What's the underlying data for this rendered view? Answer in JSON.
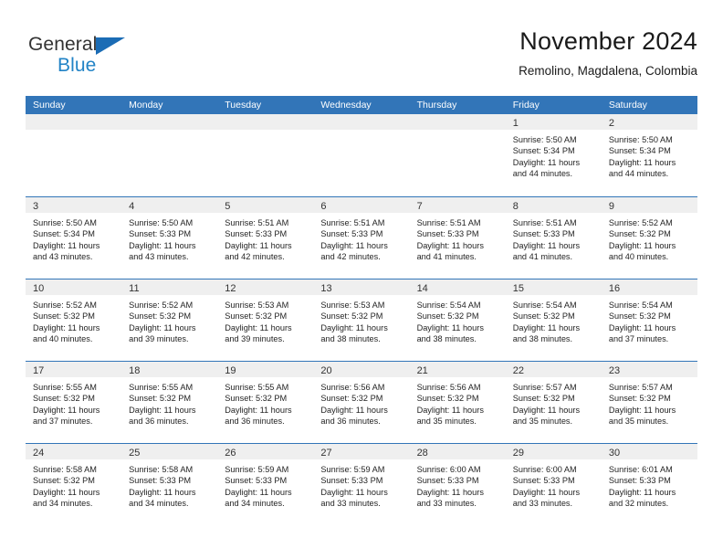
{
  "brand": {
    "name_part1": "General",
    "name_part2": "Blue",
    "accent_color": "#2283c6",
    "triangle_color": "#1b6cb5"
  },
  "header": {
    "title": "November 2024",
    "subtitle": "Remolino, Magdalena, Colombia"
  },
  "calendar": {
    "header_bg": "#3275b8",
    "daynumber_bg": "#efefef",
    "weekdays": [
      "Sunday",
      "Monday",
      "Tuesday",
      "Wednesday",
      "Thursday",
      "Friday",
      "Saturday"
    ],
    "weeks": [
      [
        {
          "day": "",
          "lines": []
        },
        {
          "day": "",
          "lines": []
        },
        {
          "day": "",
          "lines": []
        },
        {
          "day": "",
          "lines": []
        },
        {
          "day": "",
          "lines": []
        },
        {
          "day": "1",
          "lines": [
            "Sunrise: 5:50 AM",
            "Sunset: 5:34 PM",
            "Daylight: 11 hours",
            "and 44 minutes."
          ]
        },
        {
          "day": "2",
          "lines": [
            "Sunrise: 5:50 AM",
            "Sunset: 5:34 PM",
            "Daylight: 11 hours",
            "and 44 minutes."
          ]
        }
      ],
      [
        {
          "day": "3",
          "lines": [
            "Sunrise: 5:50 AM",
            "Sunset: 5:34 PM",
            "Daylight: 11 hours",
            "and 43 minutes."
          ]
        },
        {
          "day": "4",
          "lines": [
            "Sunrise: 5:50 AM",
            "Sunset: 5:33 PM",
            "Daylight: 11 hours",
            "and 43 minutes."
          ]
        },
        {
          "day": "5",
          "lines": [
            "Sunrise: 5:51 AM",
            "Sunset: 5:33 PM",
            "Daylight: 11 hours",
            "and 42 minutes."
          ]
        },
        {
          "day": "6",
          "lines": [
            "Sunrise: 5:51 AM",
            "Sunset: 5:33 PM",
            "Daylight: 11 hours",
            "and 42 minutes."
          ]
        },
        {
          "day": "7",
          "lines": [
            "Sunrise: 5:51 AM",
            "Sunset: 5:33 PM",
            "Daylight: 11 hours",
            "and 41 minutes."
          ]
        },
        {
          "day": "8",
          "lines": [
            "Sunrise: 5:51 AM",
            "Sunset: 5:33 PM",
            "Daylight: 11 hours",
            "and 41 minutes."
          ]
        },
        {
          "day": "9",
          "lines": [
            "Sunrise: 5:52 AM",
            "Sunset: 5:32 PM",
            "Daylight: 11 hours",
            "and 40 minutes."
          ]
        }
      ],
      [
        {
          "day": "10",
          "lines": [
            "Sunrise: 5:52 AM",
            "Sunset: 5:32 PM",
            "Daylight: 11 hours",
            "and 40 minutes."
          ]
        },
        {
          "day": "11",
          "lines": [
            "Sunrise: 5:52 AM",
            "Sunset: 5:32 PM",
            "Daylight: 11 hours",
            "and 39 minutes."
          ]
        },
        {
          "day": "12",
          "lines": [
            "Sunrise: 5:53 AM",
            "Sunset: 5:32 PM",
            "Daylight: 11 hours",
            "and 39 minutes."
          ]
        },
        {
          "day": "13",
          "lines": [
            "Sunrise: 5:53 AM",
            "Sunset: 5:32 PM",
            "Daylight: 11 hours",
            "and 38 minutes."
          ]
        },
        {
          "day": "14",
          "lines": [
            "Sunrise: 5:54 AM",
            "Sunset: 5:32 PM",
            "Daylight: 11 hours",
            "and 38 minutes."
          ]
        },
        {
          "day": "15",
          "lines": [
            "Sunrise: 5:54 AM",
            "Sunset: 5:32 PM",
            "Daylight: 11 hours",
            "and 38 minutes."
          ]
        },
        {
          "day": "16",
          "lines": [
            "Sunrise: 5:54 AM",
            "Sunset: 5:32 PM",
            "Daylight: 11 hours",
            "and 37 minutes."
          ]
        }
      ],
      [
        {
          "day": "17",
          "lines": [
            "Sunrise: 5:55 AM",
            "Sunset: 5:32 PM",
            "Daylight: 11 hours",
            "and 37 minutes."
          ]
        },
        {
          "day": "18",
          "lines": [
            "Sunrise: 5:55 AM",
            "Sunset: 5:32 PM",
            "Daylight: 11 hours",
            "and 36 minutes."
          ]
        },
        {
          "day": "19",
          "lines": [
            "Sunrise: 5:55 AM",
            "Sunset: 5:32 PM",
            "Daylight: 11 hours",
            "and 36 minutes."
          ]
        },
        {
          "day": "20",
          "lines": [
            "Sunrise: 5:56 AM",
            "Sunset: 5:32 PM",
            "Daylight: 11 hours",
            "and 36 minutes."
          ]
        },
        {
          "day": "21",
          "lines": [
            "Sunrise: 5:56 AM",
            "Sunset: 5:32 PM",
            "Daylight: 11 hours",
            "and 35 minutes."
          ]
        },
        {
          "day": "22",
          "lines": [
            "Sunrise: 5:57 AM",
            "Sunset: 5:32 PM",
            "Daylight: 11 hours",
            "and 35 minutes."
          ]
        },
        {
          "day": "23",
          "lines": [
            "Sunrise: 5:57 AM",
            "Sunset: 5:32 PM",
            "Daylight: 11 hours",
            "and 35 minutes."
          ]
        }
      ],
      [
        {
          "day": "24",
          "lines": [
            "Sunrise: 5:58 AM",
            "Sunset: 5:32 PM",
            "Daylight: 11 hours",
            "and 34 minutes."
          ]
        },
        {
          "day": "25",
          "lines": [
            "Sunrise: 5:58 AM",
            "Sunset: 5:33 PM",
            "Daylight: 11 hours",
            "and 34 minutes."
          ]
        },
        {
          "day": "26",
          "lines": [
            "Sunrise: 5:59 AM",
            "Sunset: 5:33 PM",
            "Daylight: 11 hours",
            "and 34 minutes."
          ]
        },
        {
          "day": "27",
          "lines": [
            "Sunrise: 5:59 AM",
            "Sunset: 5:33 PM",
            "Daylight: 11 hours",
            "and 33 minutes."
          ]
        },
        {
          "day": "28",
          "lines": [
            "Sunrise: 6:00 AM",
            "Sunset: 5:33 PM",
            "Daylight: 11 hours",
            "and 33 minutes."
          ]
        },
        {
          "day": "29",
          "lines": [
            "Sunrise: 6:00 AM",
            "Sunset: 5:33 PM",
            "Daylight: 11 hours",
            "and 33 minutes."
          ]
        },
        {
          "day": "30",
          "lines": [
            "Sunrise: 6:01 AM",
            "Sunset: 5:33 PM",
            "Daylight: 11 hours",
            "and 32 minutes."
          ]
        }
      ]
    ]
  }
}
